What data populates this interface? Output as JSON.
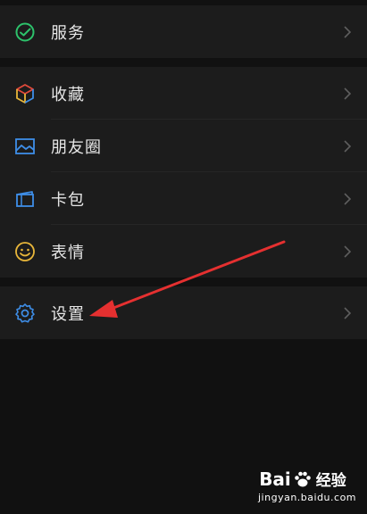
{
  "menu": {
    "services": {
      "label": "服务",
      "icon": "services-icon"
    },
    "favorites": {
      "label": "收藏",
      "icon": "favorites-cube-icon"
    },
    "moments": {
      "label": "朋友圈",
      "icon": "moments-photo-icon"
    },
    "cards": {
      "label": "卡包",
      "icon": "card-wallet-icon"
    },
    "stickers": {
      "label": "表情",
      "icon": "smiley-icon"
    },
    "settings": {
      "label": "设置",
      "icon": "gear-icon"
    }
  },
  "annotation": {
    "arrow_color": "#e53030",
    "points_to": "settings"
  },
  "watermark": {
    "brand": "Bai",
    "brand_cn": "经验",
    "url": "jingyan.baidu.com"
  },
  "colors": {
    "background": "#111111",
    "row_background": "#1c1c1c",
    "text": "#e6e6e6",
    "services_green": "#2dc26b",
    "blue": "#3e8ee8",
    "smiley_yellow": "#e8b63a"
  }
}
